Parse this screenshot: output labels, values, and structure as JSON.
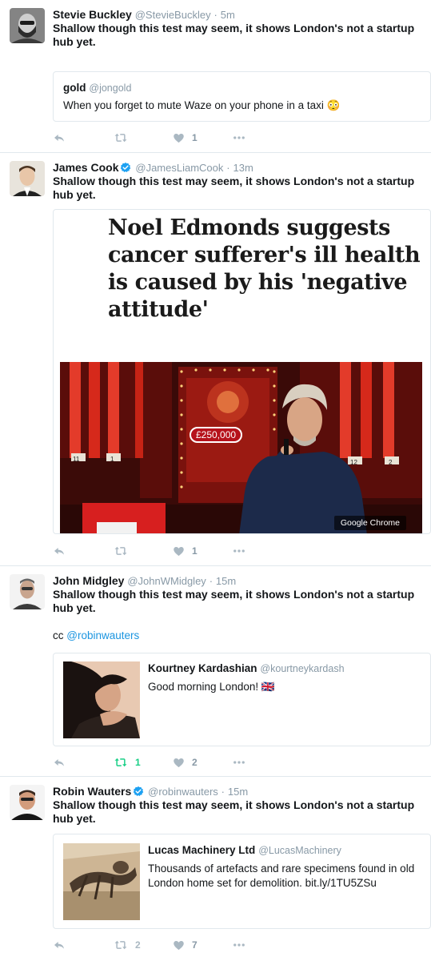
{
  "tweets": [
    {
      "name": "Stevie Buckley",
      "handle": "@StevieBuckley",
      "dot": "·",
      "time": "5m",
      "text": "Shallow though this test may seem, it shows London's not a startup hub yet.",
      "quote": {
        "name": "gold",
        "handle": "@jongold",
        "text": "When you forget to mute Waze on your phone in a taxi",
        "emoji": "😳"
      },
      "counts": {
        "retweets": "",
        "likes": "1"
      }
    },
    {
      "name": "James Cook",
      "handle": "@JamesLiamCook",
      "dot": "·",
      "time": "13m",
      "verified": true,
      "text": "Shallow though this test may seem, it shows London's not a startup hub yet.",
      "card": {
        "headline": "Noel Edmonds suggests cancer sufferer's ill health is caused by his 'negative attitude'",
        "prize": "£250,000",
        "badge": "Google Chrome",
        "box_left_1": "11",
        "box_left_2": "1",
        "box_right_1": "12",
        "box_right_2": "2"
      },
      "counts": {
        "retweets": "",
        "likes": "1"
      }
    },
    {
      "name": "John Midgley",
      "handle": "@JohnWMidgley",
      "dot": "·",
      "time": "15m",
      "text": "Shallow though this test may seem, it shows London's not a startup hub yet.",
      "extra_prefix": "cc",
      "extra_mention": "@robinwauters",
      "quote": {
        "name": "Kourtney Kardashian",
        "handle": "@kourtneykardash",
        "text": "Good morning London!",
        "emoji": "🇬🇧"
      },
      "counts": {
        "retweets": "1",
        "likes": "2"
      }
    },
    {
      "name": "Robin Wauters",
      "handle": "@robinwauters",
      "dot": "·",
      "time": "15m",
      "verified": true,
      "text": "Shallow though this test may seem, it shows London's not a startup hub yet.",
      "quote": {
        "name": "Lucas Machinery Ltd",
        "handle": "@LucasMachinery",
        "text": "Thousands of artefacts and rare specimens found in old London home set for demolition. bit.ly/1TU5ZSu"
      },
      "counts": {
        "retweets": "2",
        "likes": "7"
      }
    }
  ],
  "icons": {
    "reply": "reply-icon",
    "retweet": "retweet-icon",
    "like": "heart-icon",
    "more": "more-icon",
    "verified": "verified-badge-icon"
  },
  "colors": {
    "icon_gray": "#aab8c2",
    "retweet_active": "#19cf86",
    "link_blue": "#1b95e0",
    "verified_blue": "#1da1f2"
  }
}
